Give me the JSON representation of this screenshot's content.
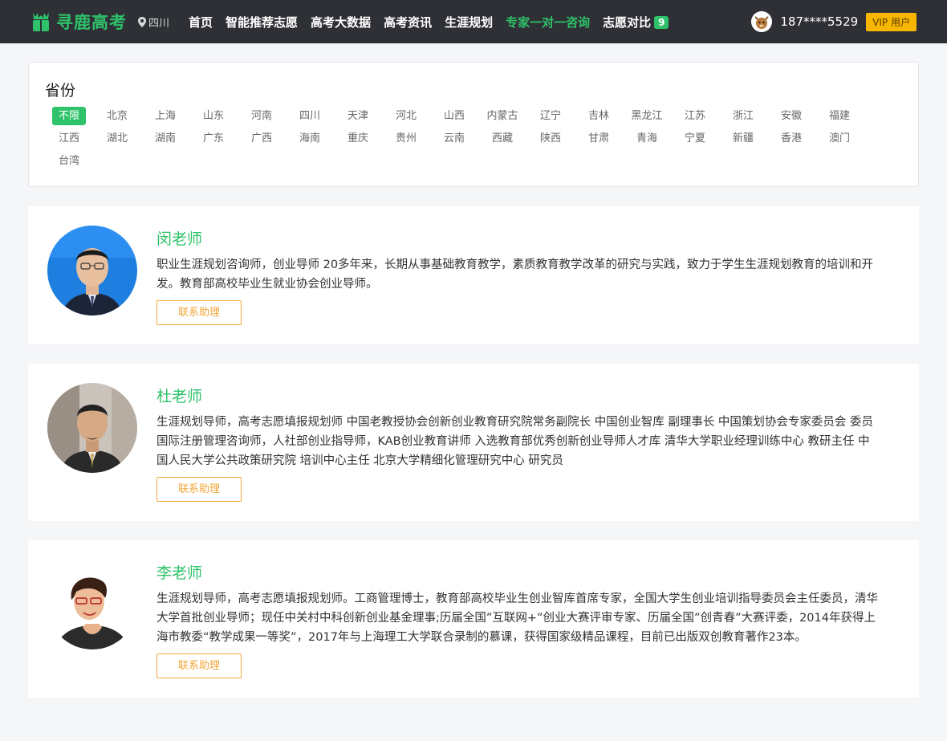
{
  "header": {
    "logo_text": "寻鹿高考",
    "location": "四川",
    "nav": [
      {
        "label": "首页"
      },
      {
        "label": "智能推荐志愿"
      },
      {
        "label": "高考大数据"
      },
      {
        "label": "高考资讯"
      },
      {
        "label": "生涯规划"
      },
      {
        "label": "专家一对一咨询"
      },
      {
        "label": "志愿对比"
      }
    ],
    "compare_count": "9",
    "phone": "187****5529",
    "vip_label": "VIP 用户",
    "accent_color": "#2ec26a"
  },
  "filter": {
    "title": "省份",
    "provinces": [
      "不限",
      "北京",
      "上海",
      "山东",
      "河南",
      "四川",
      "天津",
      "河北",
      "山西",
      "内蒙古",
      "辽宁",
      "吉林",
      "黑龙江",
      "江苏",
      "浙江",
      "安徽",
      "福建",
      "江西",
      "湖北",
      "湖南",
      "广东",
      "广西",
      "海南",
      "重庆",
      "贵州",
      "云南",
      "西藏",
      "陕西",
      "甘肃",
      "青海",
      "宁夏",
      "新疆",
      "香港",
      "澳门",
      "台湾"
    ],
    "selected": "不限"
  },
  "teachers": [
    {
      "name": "闵老师",
      "desc": "职业生涯规划咨询师，创业导师 20多年来，长期从事基础教育教学，素质教育教学改革的研究与实践，致力于学生生涯规划教育的培训和开发。教育部高校毕业生就业协会创业导师。",
      "button": "联系助理"
    },
    {
      "name": "杜老师",
      "desc": "生涯规划导师，高考志愿填报规划师 中国老教授协会创新创业教育研究院常务副院长 中国创业智库 副理事长 中国策划协会专家委员会 委员 国际注册管理咨询师，人社部创业指导师，KAB创业教育讲师 入选教育部优秀创新创业导师人才库 清华大学职业经理训练中心 教研主任 中国人民大学公共政策研究院 培训中心主任 北京大学精细化管理研究中心 研究员",
      "button": "联系助理"
    },
    {
      "name": "李老师",
      "desc": "生涯规划导师，高考志愿填报规划师。工商管理博士，教育部高校毕业生创业智库首席专家，全国大学生创业培训指导委员会主任委员，清华大学首批创业导师；现任中关村中科创新创业基金理事;历届全国”互联网+”创业大赛评审专家、历届全国”创青春”大赛评委，2014年获得上海市教委“教学成果一等奖”，2017年与上海理工大学联合录制的慕课，获得国家级精品课程，目前已出版双创教育著作23本。",
      "button": "联系助理"
    }
  ]
}
